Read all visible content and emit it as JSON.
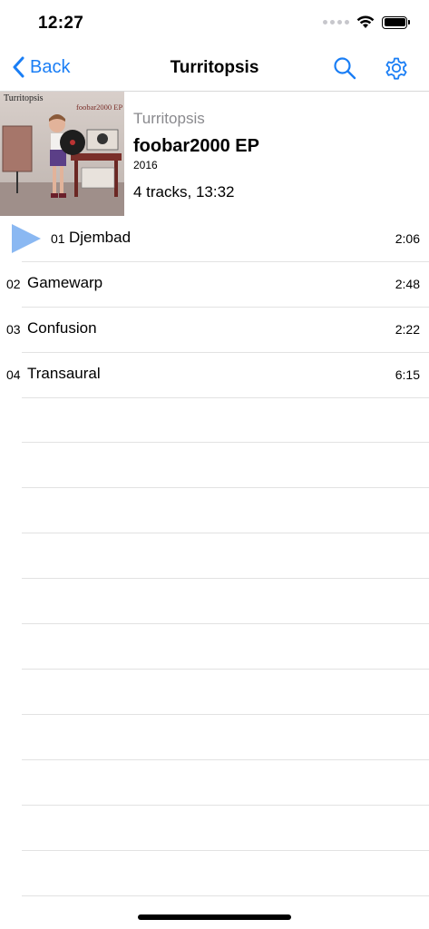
{
  "status": {
    "time": "12:27"
  },
  "nav": {
    "back_label": "Back",
    "title": "Turritopsis"
  },
  "album": {
    "artist": "Turritopsis",
    "title": "foobar2000 EP",
    "year": "2016",
    "summary": "4 tracks, 13:32",
    "art_text_artist": "Turritopsis",
    "art_text_title": "foobar2000 EP"
  },
  "tracks": [
    {
      "number": "01",
      "title": "Djembad",
      "duration": "2:06",
      "playing": true
    },
    {
      "number": "02",
      "title": "Gamewarp",
      "duration": "2:48",
      "playing": false
    },
    {
      "number": "03",
      "title": "Confusion",
      "duration": "2:22",
      "playing": false
    },
    {
      "number": "04",
      "title": "Transaural",
      "duration": "6:15",
      "playing": false
    }
  ],
  "colors": {
    "accent": "#1a7ef5",
    "play_icon": "#8ab8f2",
    "separator": "#e2e2e2"
  }
}
